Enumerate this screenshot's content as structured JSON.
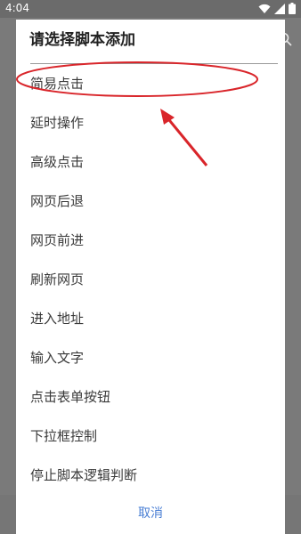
{
  "status_bar": {
    "time": "4:04"
  },
  "dialog": {
    "title": "请选择脚本添加",
    "options": [
      "简易点击",
      "延时操作",
      "高级点击",
      "网页后退",
      "网页前进",
      "刷新网页",
      "进入地址",
      "输入文字",
      "点击表单按钮",
      "下拉框控制",
      "停止脚本逻辑判断"
    ],
    "cancel_label": "取消"
  },
  "colors": {
    "accent": "#4a7fd4",
    "annotation": "#d9252a",
    "scrim": "#6e6e6e"
  },
  "icons": [
    "wifi-icon",
    "signal-icon",
    "battery-icon",
    "search-icon"
  ]
}
